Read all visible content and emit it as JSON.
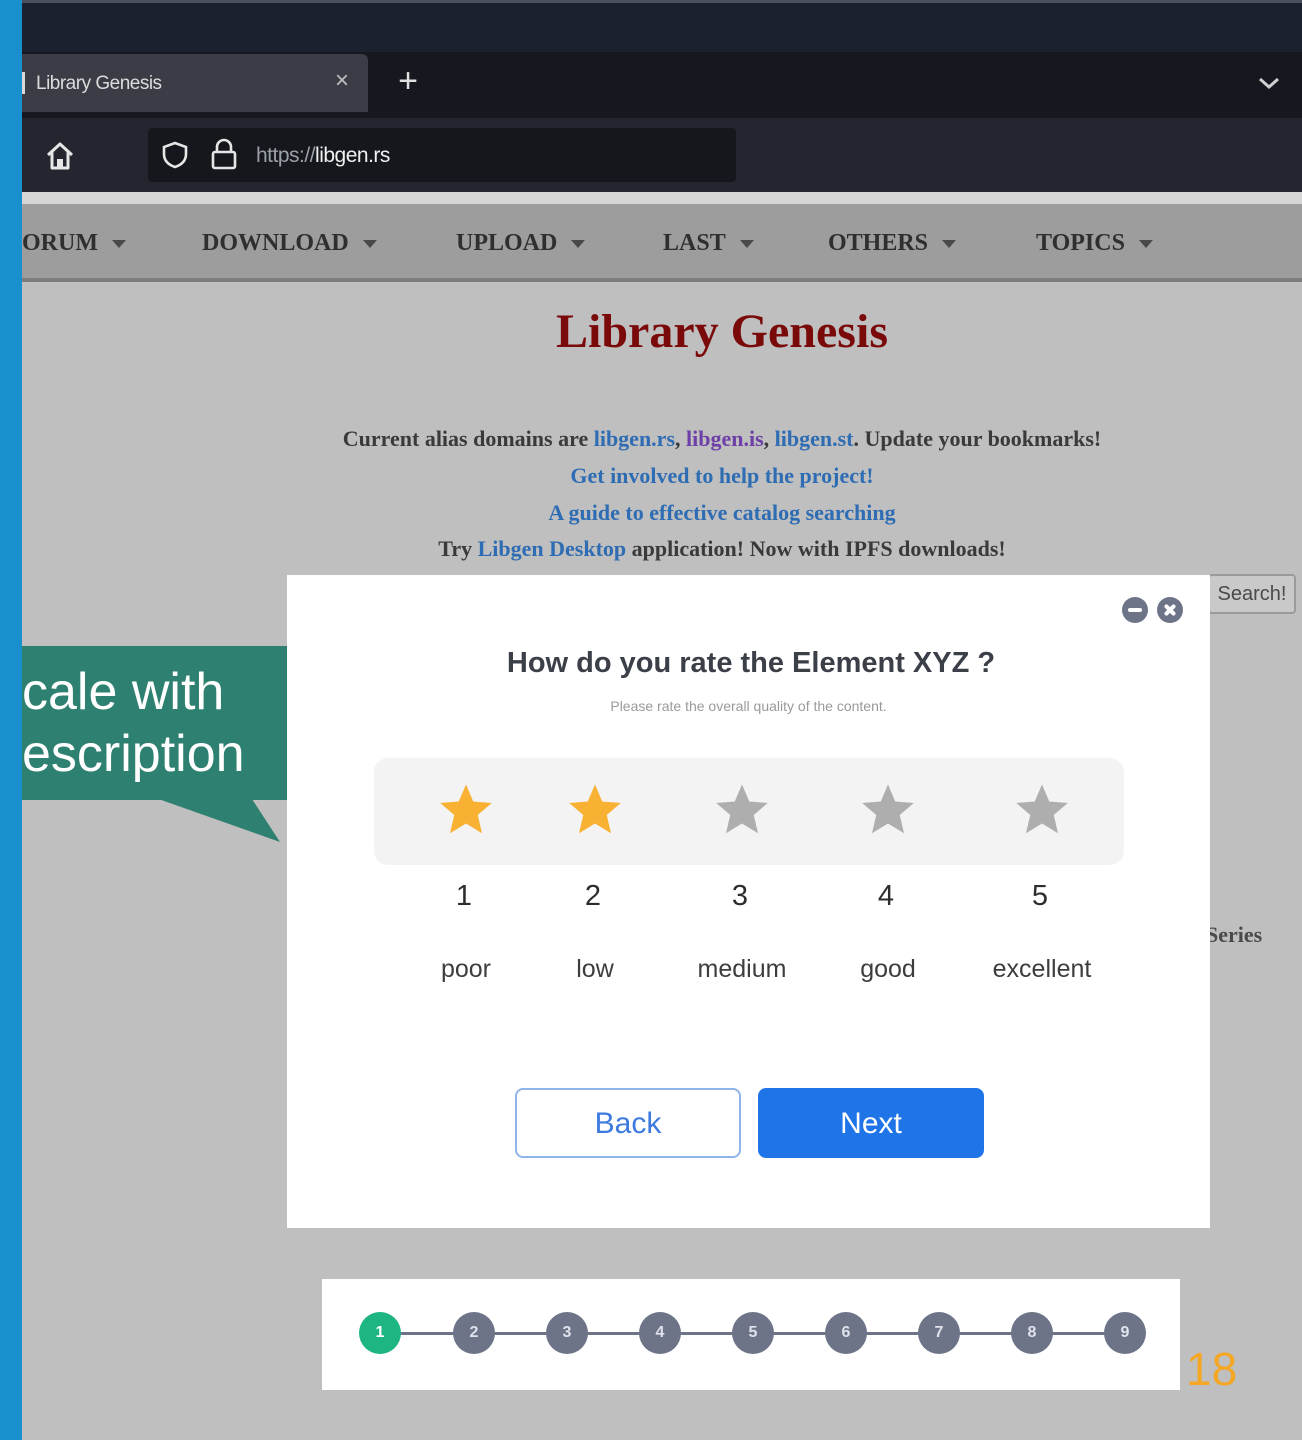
{
  "browser": {
    "tab_title": "Library Genesis",
    "tab_close": "×",
    "new_tab": "+",
    "url_prefix": "https://",
    "url_domain": "libgen.rs"
  },
  "site": {
    "menu": [
      "ORUM",
      "DOWNLOAD",
      "UPLOAD",
      "LAST",
      "OTHERS",
      "TOPICS"
    ],
    "title": "Library Genesis",
    "alias_prefix": "Current alias domains are ",
    "alias_links": [
      "libgen.rs",
      "libgen.is",
      "libgen.st"
    ],
    "alias_suffix": ". Update your bookmarks!",
    "get_involved": "Get involved to help the project!",
    "guide": "A guide to effective catalog searching",
    "try_prefix": "Try ",
    "desktop_link": "Libgen Desktop",
    "try_suffix": " application! Now with IPFS downloads!",
    "search_button": "Search!",
    "series_fragment": "Series"
  },
  "callout": {
    "line1": "cale with",
    "line2": "escription",
    "color": "#2e8070"
  },
  "modal": {
    "question": "How do you rate the Element XYZ ?",
    "subtitle": "Please rate the overall quality of the content.",
    "rating": {
      "selected": 2,
      "max": 5
    },
    "ratings": [
      {
        "number": "1",
        "label": "poor"
      },
      {
        "number": "2",
        "label": "low"
      },
      {
        "number": "3",
        "label": "medium"
      },
      {
        "number": "4",
        "label": "good"
      },
      {
        "number": "5",
        "label": "excellent"
      }
    ],
    "back_label": "Back",
    "next_label": "Next",
    "star_active_color": "#f8b133",
    "star_inactive_color": "#aeaeae",
    "accent_color": "#1f75e8"
  },
  "stepper": {
    "steps": [
      "1",
      "2",
      "3",
      "4",
      "5",
      "6",
      "7",
      "8",
      "9"
    ],
    "current": 1,
    "active_color": "#1db683"
  },
  "page_number": "18"
}
